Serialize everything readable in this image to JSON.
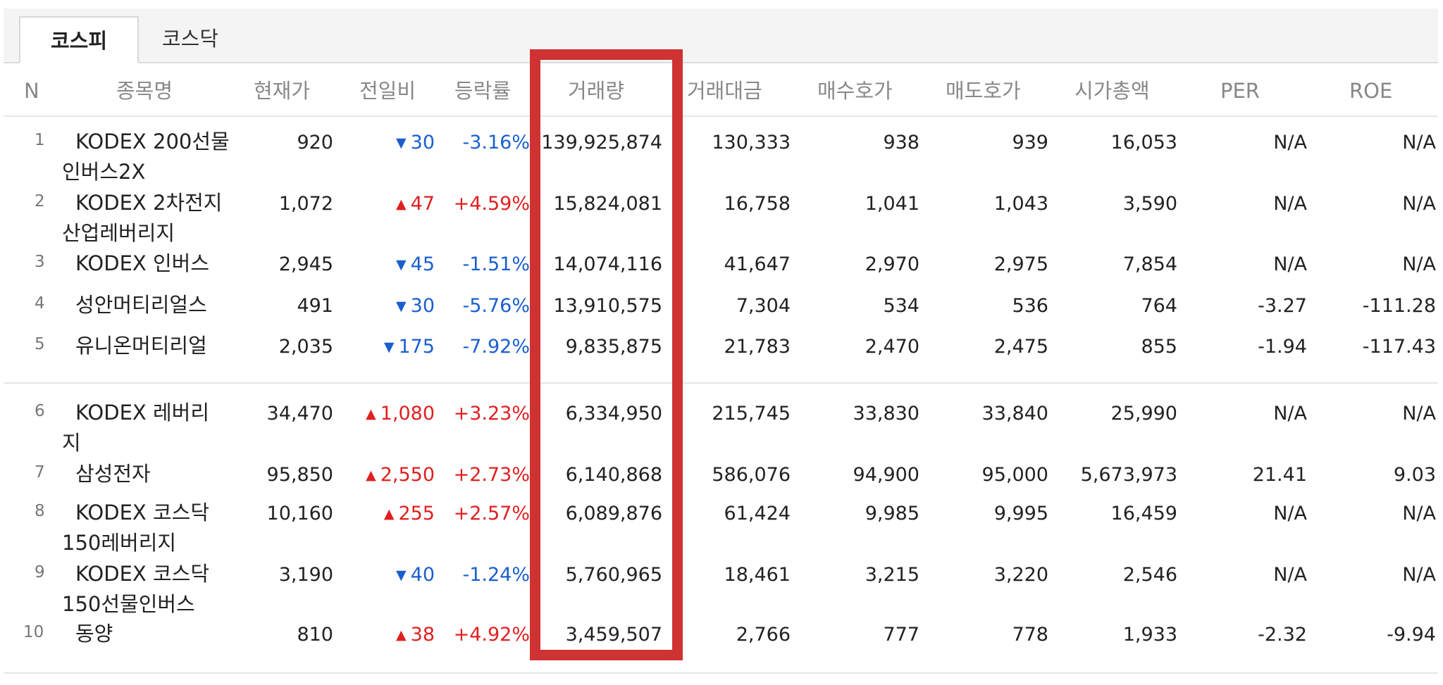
{
  "tabs": [
    {
      "label": "코스피",
      "active": true
    },
    {
      "label": "코스닥",
      "active": false
    }
  ],
  "columns": [
    "N",
    "종목명",
    "현재가",
    "전일비",
    "등락률",
    "거래량",
    "거래대금",
    "매수호가",
    "매도호가",
    "시가총액",
    "PER",
    "ROE"
  ],
  "rows": [
    {
      "n": "1",
      "name_l1": "KODEX 200선물",
      "name_l2": "인버스2X",
      "price": "920",
      "dir": "down",
      "change": "30",
      "rate": "-3.16%",
      "volume": "139,925,874",
      "amount": "130,333",
      "bid": "938",
      "ask": "939",
      "mcap": "16,053",
      "per": "N/A",
      "roe": "N/A"
    },
    {
      "n": "2",
      "name_l1": "KODEX 2차전지",
      "name_l2": "산업레버리지",
      "price": "1,072",
      "dir": "up",
      "change": "47",
      "rate": "+4.59%",
      "volume": "15,824,081",
      "amount": "16,758",
      "bid": "1,041",
      "ask": "1,043",
      "mcap": "3,590",
      "per": "N/A",
      "roe": "N/A"
    },
    {
      "n": "3",
      "name_l1": "KODEX 인버스",
      "name_l2": "",
      "price": "2,945",
      "dir": "down",
      "change": "45",
      "rate": "-1.51%",
      "volume": "14,074,116",
      "amount": "41,647",
      "bid": "2,970",
      "ask": "2,975",
      "mcap": "7,854",
      "per": "N/A",
      "roe": "N/A"
    },
    {
      "n": "4",
      "name_l1": "성안머티리얼스",
      "name_l2": "",
      "price": "491",
      "dir": "down",
      "change": "30",
      "rate": "-5.76%",
      "volume": "13,910,575",
      "amount": "7,304",
      "bid": "534",
      "ask": "536",
      "mcap": "764",
      "per": "-3.27",
      "roe": "-111.28"
    },
    {
      "n": "5",
      "name_l1": "유니온머티리얼",
      "name_l2": "",
      "price": "2,035",
      "dir": "down",
      "change": "175",
      "rate": "-7.92%",
      "volume": "9,835,875",
      "amount": "21,783",
      "bid": "2,470",
      "ask": "2,475",
      "mcap": "855",
      "per": "-1.94",
      "roe": "-117.43"
    },
    {
      "n": "6",
      "name_l1": "KODEX 레버리",
      "name_l2": "지",
      "price": "34,470",
      "dir": "up",
      "change": "1,080",
      "rate": "+3.23%",
      "volume": "6,334,950",
      "amount": "215,745",
      "bid": "33,830",
      "ask": "33,840",
      "mcap": "25,990",
      "per": "N/A",
      "roe": "N/A"
    },
    {
      "n": "7",
      "name_l1": "삼성전자",
      "name_l2": "",
      "price": "95,850",
      "dir": "up",
      "change": "2,550",
      "rate": "+2.73%",
      "volume": "6,140,868",
      "amount": "586,076",
      "bid": "94,900",
      "ask": "95,000",
      "mcap": "5,673,973",
      "per": "21.41",
      "roe": "9.03"
    },
    {
      "n": "8",
      "name_l1": "KODEX 코스닥",
      "name_l2": "150레버리지",
      "price": "10,160",
      "dir": "up",
      "change": "255",
      "rate": "+2.57%",
      "volume": "6,089,876",
      "amount": "61,424",
      "bid": "9,985",
      "ask": "9,995",
      "mcap": "16,459",
      "per": "N/A",
      "roe": "N/A"
    },
    {
      "n": "9",
      "name_l1": "KODEX 코스닥",
      "name_l2": "150선물인버스",
      "price": "3,190",
      "dir": "down",
      "change": "40",
      "rate": "-1.24%",
      "volume": "5,760,965",
      "amount": "18,461",
      "bid": "3,215",
      "ask": "3,220",
      "mcap": "2,546",
      "per": "N/A",
      "roe": "N/A"
    },
    {
      "n": "10",
      "name_l1": "동양",
      "name_l2": "",
      "price": "810",
      "dir": "up",
      "change": "38",
      "rate": "+4.92%",
      "volume": "3,459,507",
      "amount": "2,766",
      "bid": "777",
      "ask": "778",
      "mcap": "1,933",
      "per": "-2.32",
      "roe": "-9.94"
    }
  ],
  "icons": {
    "up": "triangle-up-icon",
    "down": "triangle-down-icon"
  },
  "colors": {
    "up": "#e02020",
    "down": "#1a5fd0",
    "highlight": "#cf3232"
  }
}
